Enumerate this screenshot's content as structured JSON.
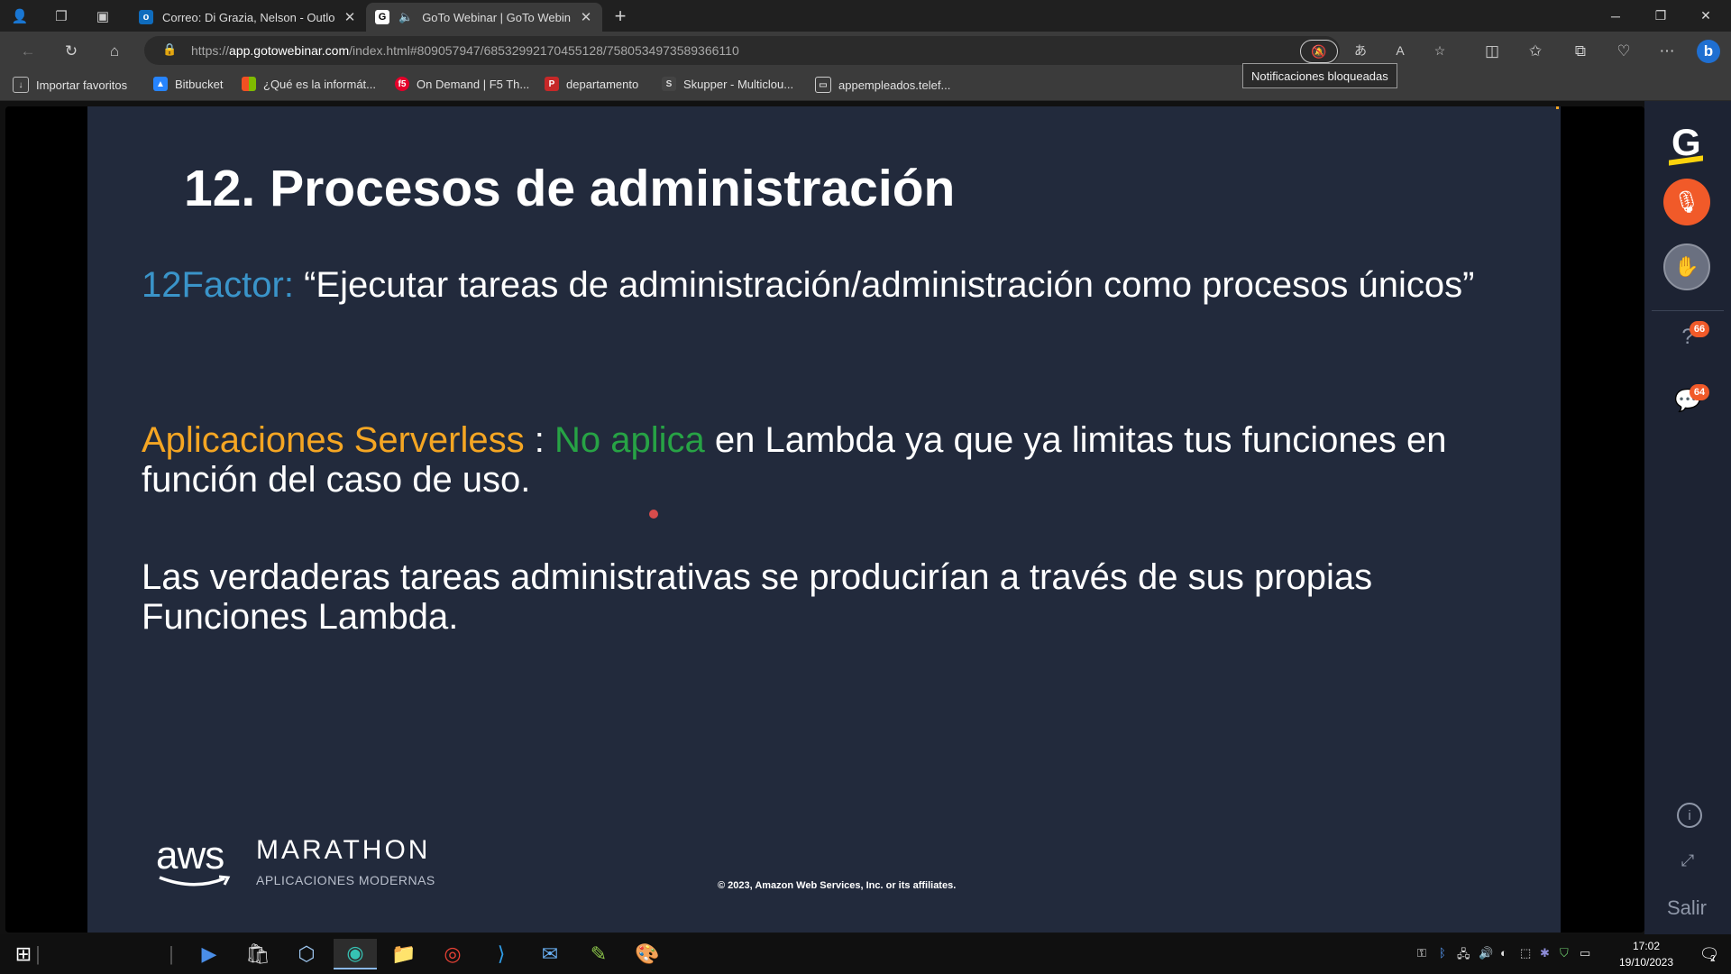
{
  "browser": {
    "tabs": [
      {
        "title": "Correo: Di Grazia, Nelson - Outlo",
        "favicon": "outlook-icon",
        "active": false
      },
      {
        "title": "GoTo Webinar | GoTo Webin",
        "favicon": "goto-icon",
        "active": true
      }
    ],
    "new_tab": "+",
    "url_scheme": "https://",
    "url_host": "app.gotowebinar.com",
    "url_path": "/index.html#809057947/6853299217045512​8/7580534973589366110",
    "tooltip": "Notificaciones bloqueadas",
    "favorites": [
      {
        "label": "Importar favoritos",
        "icon": "import-icon"
      },
      {
        "label": "Bitbucket",
        "icon": "bitbucket-icon"
      },
      {
        "label": "¿Qué es la informát...",
        "icon": "windows-icon"
      },
      {
        "label": "On Demand | F5 Th...",
        "icon": "f5-icon"
      },
      {
        "label": "departamento",
        "icon": "pdf-icon"
      },
      {
        "label": "Skupper - Multiclou...",
        "icon": "skupper-icon"
      },
      {
        "label": "appempleados.telef...",
        "icon": "page-icon"
      }
    ]
  },
  "slide": {
    "title": "12. Procesos de administración",
    "p1_label": "12Factor:",
    "p1_text": " “Ejecutar tareas de administración/administración como procesos únicos”",
    "p2_label": "Aplicaciones Serverless",
    "p2_sep": " : ",
    "p2_highlight": "No aplica",
    "p2_text": " en Lambda ya que ya limitas tus funciones en función del caso de uso.",
    "p3_text": "Las verdaderas tareas administrativas se producirían a través de sus propias Funciones Lambda.",
    "aws": "aws",
    "brand": "MARATHON",
    "brand_sub": "APLICACIONES MODERNAS",
    "copyright": "© 2023, Amazon Web Services, Inc. or its affiliates."
  },
  "rail": {
    "logo": "G",
    "questions_badge": "66",
    "chat_badge": "64",
    "exit": "Salir"
  },
  "taskbar": {
    "time": "17:02",
    "date": "19/10/2023",
    "notifications": "2"
  },
  "colors": {
    "slide_bg": "#222a3c",
    "accent_blue": "#3a94c9",
    "accent_orange": "#f5a623",
    "accent_green": "#27a345",
    "goto_orange": "#f15a29"
  }
}
